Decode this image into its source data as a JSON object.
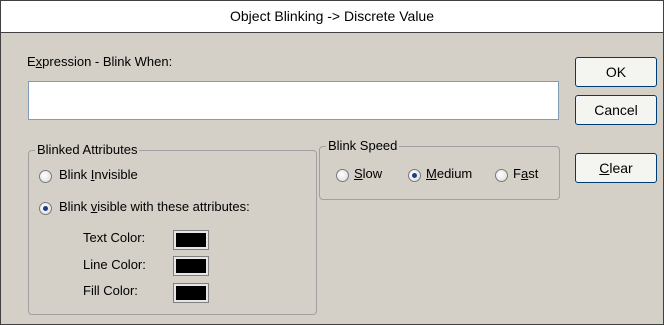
{
  "title": "Object Blinking -> Discrete Value",
  "expression": {
    "label_prefix": "E",
    "label_accel": "x",
    "label_rest": "pression - Blink When:",
    "value": ""
  },
  "buttons": {
    "ok": "OK",
    "cancel": "Cancel",
    "clear_accel": "C",
    "clear_rest": "lear"
  },
  "blinked_attributes": {
    "group_label": "Blinked Attributes",
    "invisible_prefix": "Blink ",
    "invisible_accel": "I",
    "invisible_rest": "nvisible",
    "visible_prefix": "Blink ",
    "visible_accel": "v",
    "visible_rest": "isible with these attributes:",
    "selected": "visible",
    "text_color_label": "Text Color:",
    "line_color_label": "Line Color:",
    "fill_color_label": "Fill Color:",
    "text_color": "#000000",
    "line_color": "#000000",
    "fill_color": "#000000"
  },
  "blink_speed": {
    "group_label": "Blink Speed",
    "slow_accel": "S",
    "slow_rest": "low",
    "medium_accel": "M",
    "medium_rest": "edium",
    "fast_prefix": "F",
    "fast_accel": "a",
    "fast_rest": "st",
    "selected": "medium"
  }
}
